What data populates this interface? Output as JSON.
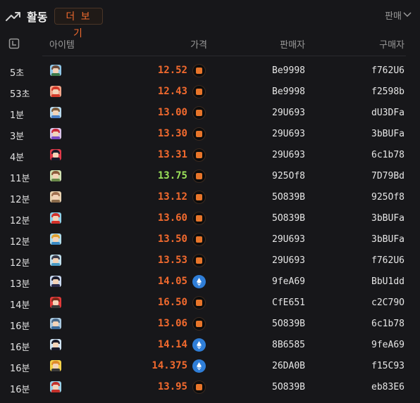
{
  "header": {
    "title": "활동",
    "more_label": "더 보기",
    "filter_label": "판매"
  },
  "columns": {
    "item": "아이템",
    "price": "가격",
    "seller": "판매자",
    "buyer": "구매자"
  },
  "colors": {
    "price_orange": "#f26a2e",
    "price_green": "#9be15a",
    "eth_blue": "#2f7ed8",
    "ape_orange": "#e8752a"
  },
  "rows": [
    {
      "time": "5초",
      "price": "12.52",
      "currency": "ape-coin-icon",
      "seller": "Be9998",
      "buyer": "f762U6",
      "highlight": false,
      "avatar": {
        "bg": "#8fc7e8",
        "hair": "#6b4a3a",
        "body": "#3c7a4a"
      }
    },
    {
      "time": "53초",
      "price": "12.43",
      "currency": "ape-coin-icon",
      "seller": "Be9998",
      "buyer": "f2598b",
      "highlight": false,
      "avatar": {
        "bg": "#f1a58a",
        "hair": "#d23a2a",
        "body": "#d23a2a"
      }
    },
    {
      "time": "1분",
      "price": "13.00",
      "currency": "ape-coin-icon",
      "seller": "29U693",
      "buyer": "dU3DFa",
      "highlight": false,
      "avatar": {
        "bg": "#b7d9ee",
        "hair": "#7b5a3a",
        "body": "#4a7fc4"
      }
    },
    {
      "time": "3분",
      "price": "13.30",
      "currency": "ape-coin-icon",
      "seller": "29U693",
      "buyer": "3bBUFa",
      "highlight": false,
      "avatar": {
        "bg": "#d9c2e8",
        "hair": "#c92a3a",
        "body": "#7a4ac4"
      }
    },
    {
      "time": "4분",
      "price": "13.31",
      "currency": "ape-coin-icon",
      "seller": "29U693",
      "buyer": "6c1b78",
      "highlight": false,
      "avatar": {
        "bg": "#e23a4a",
        "hair": "#1a1a2a",
        "body": "#1a1a2a"
      }
    },
    {
      "time": "11분",
      "price": "13.75",
      "currency": "ape-coin-icon",
      "seller": "925Of8",
      "buyer": "7D79Bd",
      "highlight": true,
      "avatar": {
        "bg": "#cfe0b0",
        "hair": "#8a5a3a",
        "body": "#6a8a4a"
      }
    },
    {
      "time": "12분",
      "price": "13.12",
      "currency": "ape-coin-icon",
      "seller": "5O839B",
      "buyer": "925Of8",
      "highlight": false,
      "avatar": {
        "bg": "#e8d2b0",
        "hair": "#a07050",
        "body": "#8a6a4a"
      }
    },
    {
      "time": "12분",
      "price": "13.60",
      "currency": "ape-coin-icon",
      "seller": "5O839B",
      "buyer": "3bBUFa",
      "highlight": false,
      "avatar": {
        "bg": "#8fd0e8",
        "hair": "#d2302a",
        "body": "#d2302a"
      }
    },
    {
      "time": "12분",
      "price": "13.50",
      "currency": "ape-coin-icon",
      "seller": "29U693",
      "buyer": "3bBUFa",
      "highlight": false,
      "avatar": {
        "bg": "#b0dcea",
        "hair": "#e0a030",
        "body": "#3a8ac4"
      }
    },
    {
      "time": "12분",
      "price": "13.53",
      "currency": "ape-coin-icon",
      "seller": "29U693",
      "buyer": "f762U6",
      "highlight": false,
      "avatar": {
        "bg": "#c0e0ee",
        "hair": "#3a3a4a",
        "body": "#4a9ac4"
      }
    },
    {
      "time": "13분",
      "price": "14.05",
      "currency": "eth-coin-icon",
      "seller": "9feA69",
      "buyer": "BbU1dd",
      "highlight": false,
      "avatar": {
        "bg": "#c8d8f0",
        "hair": "#1a1a2a",
        "body": "#2a2a4a"
      }
    },
    {
      "time": "14분",
      "price": "16.50",
      "currency": "ape-coin-icon",
      "seller": "CfE651",
      "buyer": "c2C79O",
      "highlight": false,
      "avatar": {
        "bg": "#e23a3a",
        "hair": "#7a2a1a",
        "body": "#3a3a3a"
      }
    },
    {
      "time": "16분",
      "price": "13.06",
      "currency": "ape-coin-icon",
      "seller": "5O839B",
      "buyer": "6c1b78",
      "highlight": false,
      "avatar": {
        "bg": "#a8c8e0",
        "hair": "#4a6a8a",
        "body": "#3a6a9a"
      }
    },
    {
      "time": "16분",
      "price": "14.14",
      "currency": "eth-coin-icon",
      "seller": "8B6585",
      "buyer": "9feA69",
      "highlight": false,
      "avatar": {
        "bg": "#d0e4f4",
        "hair": "#1a1a2a",
        "body": "#1a1a2a"
      }
    },
    {
      "time": "16분",
      "price": "14.375",
      "currency": "eth-coin-icon",
      "seller": "26DA0B",
      "buyer": "f15C93",
      "highlight": false,
      "avatar": {
        "bg": "#f4d24a",
        "hair": "#e08a2a",
        "body": "#3a3a3a"
      }
    },
    {
      "time": "16분",
      "price": "13.95",
      "currency": "ape-coin-icon",
      "seller": "5O839B",
      "buyer": "eb83E6",
      "highlight": false,
      "avatar": {
        "bg": "#9ad0e8",
        "hair": "#c2302a",
        "body": "#c2302a"
      }
    }
  ]
}
